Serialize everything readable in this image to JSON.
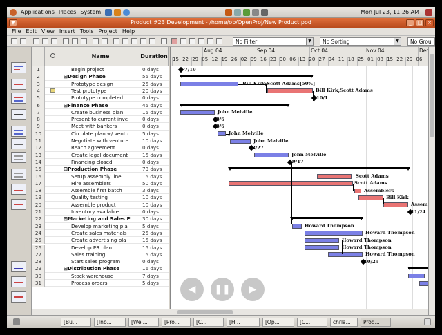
{
  "panel": {
    "menus": [
      "Applications",
      "Places",
      "System"
    ],
    "clock": "Mon Jul 23, 11:26 AM"
  },
  "window": {
    "title": "Product #23 Development - /home/ob/OpenProj/New Product.pod"
  },
  "menubar": [
    "File",
    "Edit",
    "View",
    "Insert",
    "Tools",
    "Project",
    "Help"
  ],
  "toolbar": {
    "filter": "No Filter",
    "sorting": "No Sorting",
    "group": "No Grou"
  },
  "columns": {
    "name": "Name",
    "duration": "Duration"
  },
  "tasks": [
    {
      "n": "1",
      "name": "Begin project",
      "dur": "0 days"
    },
    {
      "n": "2",
      "name": "⊟Design Phase",
      "dur": "55 days"
    },
    {
      "n": "3",
      "name": "Prototype design",
      "dur": "25 days"
    },
    {
      "n": "4",
      "name": "Test prototype",
      "dur": "20 days"
    },
    {
      "n": "5",
      "name": "Prototype completed",
      "dur": "0 days"
    },
    {
      "n": "6",
      "name": "⊟Finance Phase",
      "dur": "45 days"
    },
    {
      "n": "7",
      "name": "Create business plan",
      "dur": "15 days"
    },
    {
      "n": "8",
      "name": "Present to current inve",
      "dur": "0 days"
    },
    {
      "n": "9",
      "name": "Meet with bankers",
      "dur": "0 days"
    },
    {
      "n": "10",
      "name": "Circulate plan w/ ventu",
      "dur": "5 days"
    },
    {
      "n": "11",
      "name": "Negotiate with venture",
      "dur": "10 days"
    },
    {
      "n": "12",
      "name": "Reach agreement",
      "dur": "0 days"
    },
    {
      "n": "13",
      "name": "Create legal document",
      "dur": "15 days"
    },
    {
      "n": "14",
      "name": "Financing closed",
      "dur": "0 days"
    },
    {
      "n": "15",
      "name": "⊟Production Phase",
      "dur": "73 days"
    },
    {
      "n": "16",
      "name": "Setup assembly line",
      "dur": "15 days"
    },
    {
      "n": "17",
      "name": "Hire assemblers",
      "dur": "50 days"
    },
    {
      "n": "18",
      "name": "Assemble first batch",
      "dur": "3 days"
    },
    {
      "n": "19",
      "name": "Quality testing",
      "dur": "10 days"
    },
    {
      "n": "20",
      "name": "Assemble product",
      "dur": "10 days"
    },
    {
      "n": "21",
      "name": "Inventory available",
      "dur": "0 days"
    },
    {
      "n": "22",
      "name": "⊟Marketing and Sales P",
      "dur": "30 days"
    },
    {
      "n": "23",
      "name": "Develop marketing pla",
      "dur": "5 days"
    },
    {
      "n": "24",
      "name": "Create sales materials",
      "dur": "25 days"
    },
    {
      "n": "25",
      "name": "Create advertising pla",
      "dur": "15 days"
    },
    {
      "n": "26",
      "name": "Develop PR plan",
      "dur": "15 days"
    },
    {
      "n": "27",
      "name": "Sales training",
      "dur": "15 days"
    },
    {
      "n": "28",
      "name": "Start sales program",
      "dur": "0 days"
    },
    {
      "n": "29",
      "name": "⊟Distribution Phase",
      "dur": "16 days"
    },
    {
      "n": "30",
      "name": "Stock warehouse",
      "dur": "7 days"
    },
    {
      "n": "31",
      "name": "Process orders",
      "dur": "5 days"
    }
  ],
  "timeline": {
    "months": [
      "Aug 04",
      "Sep 04",
      "Oct 04",
      "Nov 04",
      "Dec"
    ],
    "days": [
      "15",
      "22",
      "29",
      "05",
      "12",
      "19",
      "26",
      "02",
      "09",
      "16",
      "23",
      "30",
      "06",
      "13",
      "20",
      "27",
      "04",
      "11",
      "18",
      "25",
      "01",
      "08",
      "15",
      "22",
      "29",
      "06"
    ]
  },
  "labels": {
    "l1": "7/19",
    "l3": "Bill Kirk;Scott Adams[50%]",
    "l4": "Bill Kirk;Scott Adams",
    "l5": "10/1",
    "l7": "John Melville",
    "l8": "8/6",
    "l9": "8/6",
    "l10": "John Melville",
    "l11": "John Melville",
    "l12": "8/27",
    "l13": "John Melville",
    "l14": "9/17",
    "l16": "Scott Adams",
    "l17": "Scott Adams",
    "l18": "Assemblers",
    "l19": "Bill Kirk",
    "l20": "Assem",
    "l21": "11/24",
    "l23": "Howard Thompson",
    "l24": "Howard Thompson",
    "l25": "Howard Thompson",
    "l26": "Howard Thompson",
    "l27": "Howard Thompson",
    "l28": "10/29"
  },
  "taskbar": [
    "[Bu...",
    "[Inb...",
    "[Wel...",
    "[Pro...",
    "[C...",
    "[H...",
    "[Op...",
    "[C...",
    "chrla...",
    "Prod..."
  ],
  "colors": {
    "task_bar": "#7b80e6",
    "critical_bar": "#e97474",
    "title_bar": "#c85a28"
  }
}
